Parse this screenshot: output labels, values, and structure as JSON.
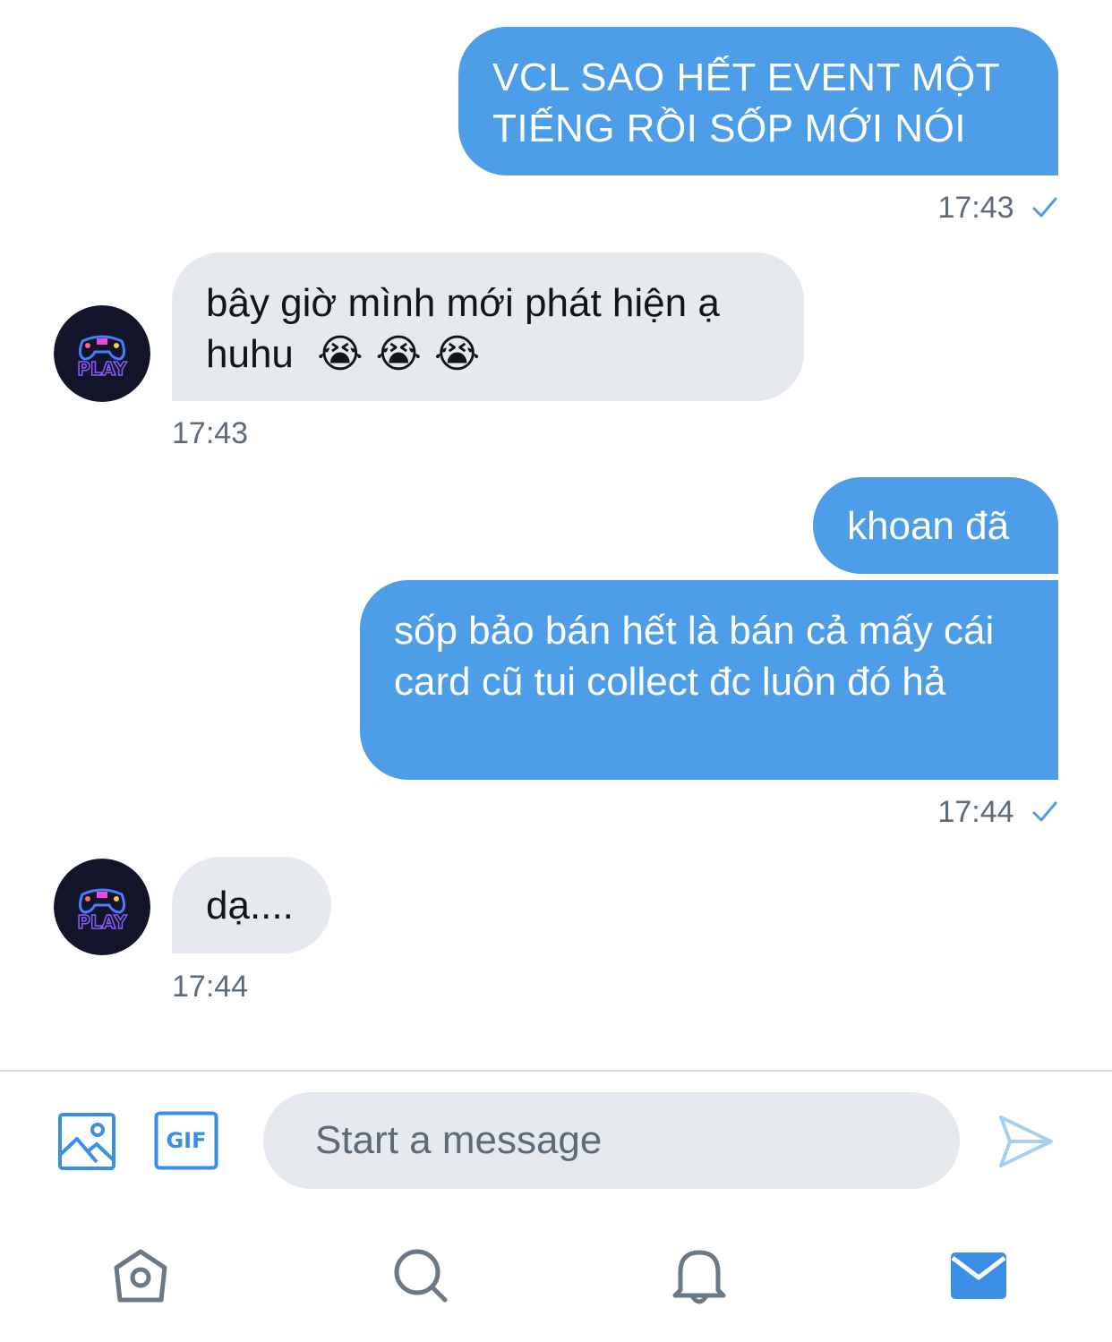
{
  "conversation": {
    "messages": [
      {
        "direction": "outgoing",
        "text": "VCL SAO HẾT EVENT MỘT TIẾNG RỒI SỐP MỚI NÓI"
      },
      {
        "direction": "outgoing",
        "timestamp": "17:43",
        "read": true
      },
      {
        "direction": "incoming",
        "text_line1": "bây giờ mình mới phát hiện ạ",
        "text_line2": "huhu",
        "emoji": "😭 😭 😭",
        "emoji_name": "loudly-crying-face"
      },
      {
        "direction": "incoming",
        "timestamp": "17:43"
      },
      {
        "direction": "outgoing",
        "text": "khoan đã"
      },
      {
        "direction": "outgoing",
        "text": "sốp bảo bán hết là bán cả mấy cái card cũ tui collect đc luôn đó hả"
      },
      {
        "direction": "outgoing",
        "timestamp": "17:44",
        "read": true
      },
      {
        "direction": "incoming",
        "text": "dạ...."
      },
      {
        "direction": "incoming",
        "timestamp": "17:44"
      }
    ],
    "avatar_text": "PLAY"
  },
  "composer": {
    "placeholder": "Start a message",
    "value": "",
    "gif_label": "GIF"
  },
  "tabbar": {
    "items": [
      "home",
      "search",
      "notifications",
      "messages"
    ],
    "active": "messages"
  },
  "colors": {
    "accent": "#4d9de8",
    "incoming_bubble": "#e6e9ee",
    "muted_text": "#5c6b79",
    "icon_blue": "#3a8ee6",
    "icon_gray": "#6b7885"
  }
}
